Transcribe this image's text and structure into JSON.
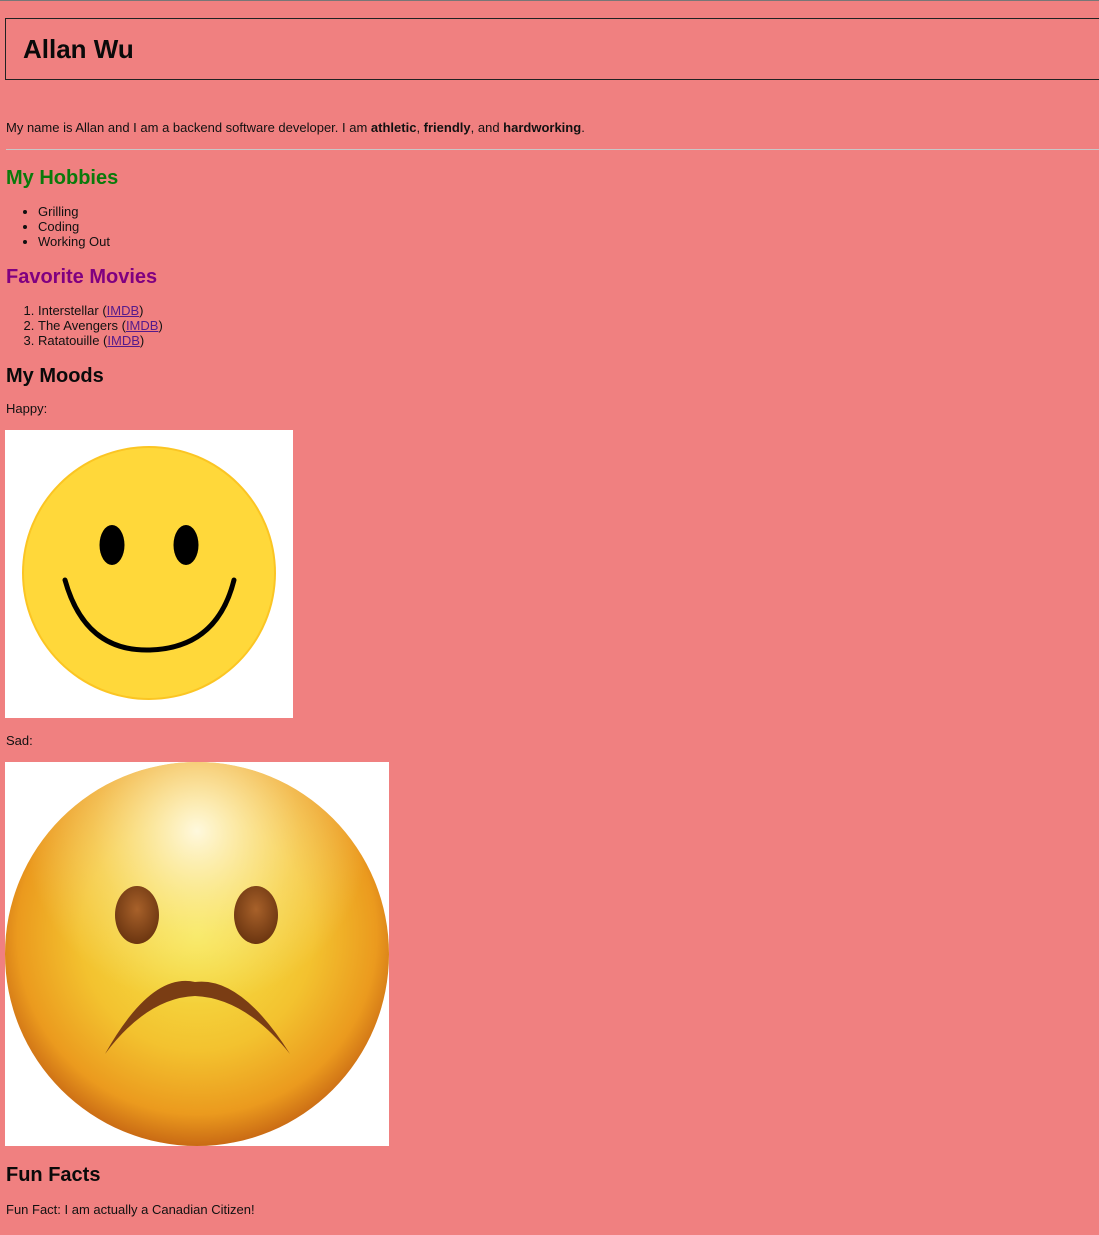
{
  "header": {
    "title": "Allan Wu"
  },
  "intro": {
    "prefix": "My name is Allan and I am a backend software developer. I am ",
    "trait1": "athletic",
    "sep1": ", ",
    "trait2": "friendly",
    "sep2": ", and ",
    "trait3": "hardworking",
    "suffix": "."
  },
  "hobbies": {
    "heading": "My Hobbies",
    "items": [
      "Grilling",
      "Coding",
      "Working Out"
    ]
  },
  "movies": {
    "heading": "Favorite Movies",
    "items": [
      {
        "title": "Interstellar",
        "link_text": "IMDB"
      },
      {
        "title": "The Avengers",
        "link_text": "IMDB"
      },
      {
        "title": "Ratatouille",
        "link_text": "IMDB"
      }
    ]
  },
  "moods": {
    "heading": "My Moods",
    "happy_label": "Happy:",
    "sad_label": "Sad:"
  },
  "fun_facts": {
    "heading": "Fun Facts",
    "text": "Fun Fact: I am actually a Canadian Citizen!"
  },
  "colors": {
    "background": "#f08080",
    "hobbies_heading": "#0b7a0b",
    "movies_heading": "#800080",
    "link": "#551a8b"
  }
}
